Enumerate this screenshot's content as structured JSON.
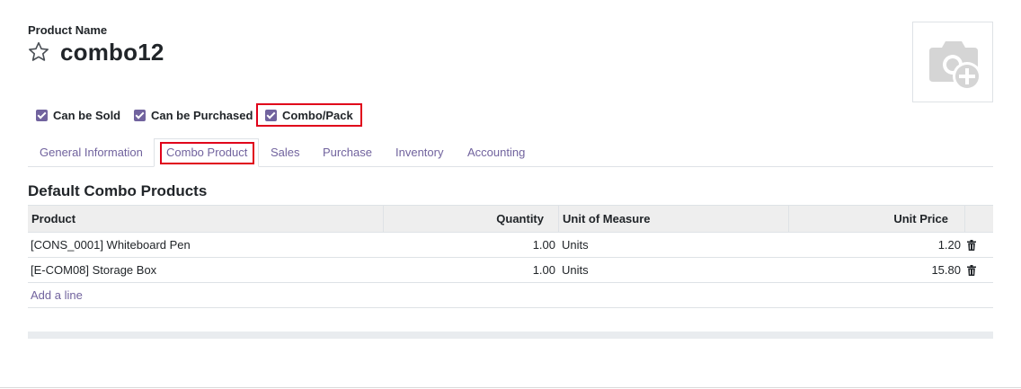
{
  "form": {
    "product_name_label": "Product Name",
    "product_name": "combo12"
  },
  "checkboxes": [
    {
      "label": "Can be Sold",
      "checked": true
    },
    {
      "label": "Can be Purchased",
      "checked": true
    },
    {
      "label": "Combo/Pack",
      "checked": true
    }
  ],
  "tabs": [
    {
      "label": "General Information"
    },
    {
      "label": "Combo Product",
      "active": true
    },
    {
      "label": "Sales"
    },
    {
      "label": "Purchase"
    },
    {
      "label": "Inventory"
    },
    {
      "label": "Accounting"
    }
  ],
  "section": {
    "title": "Default Combo Products"
  },
  "table": {
    "columns": [
      "Product",
      "Quantity",
      "Unit of Measure",
      "Unit Price"
    ],
    "rows": [
      {
        "product": "[CONS_0001] Whiteboard Pen",
        "quantity": "1.00",
        "uom": "Units",
        "unit_price": "1.20"
      },
      {
        "product": "[E-COM08] Storage Box",
        "quantity": "1.00",
        "uom": "Units",
        "unit_price": "15.80"
      }
    ],
    "add_line": "Add a line"
  },
  "colors": {
    "accent": "#71639e",
    "highlight": "#e0001a",
    "header_bg": "#eeeeee"
  },
  "icons": {
    "favorite": "star-outline-icon",
    "image": "camera-plus-icon",
    "delete": "trash-icon"
  }
}
